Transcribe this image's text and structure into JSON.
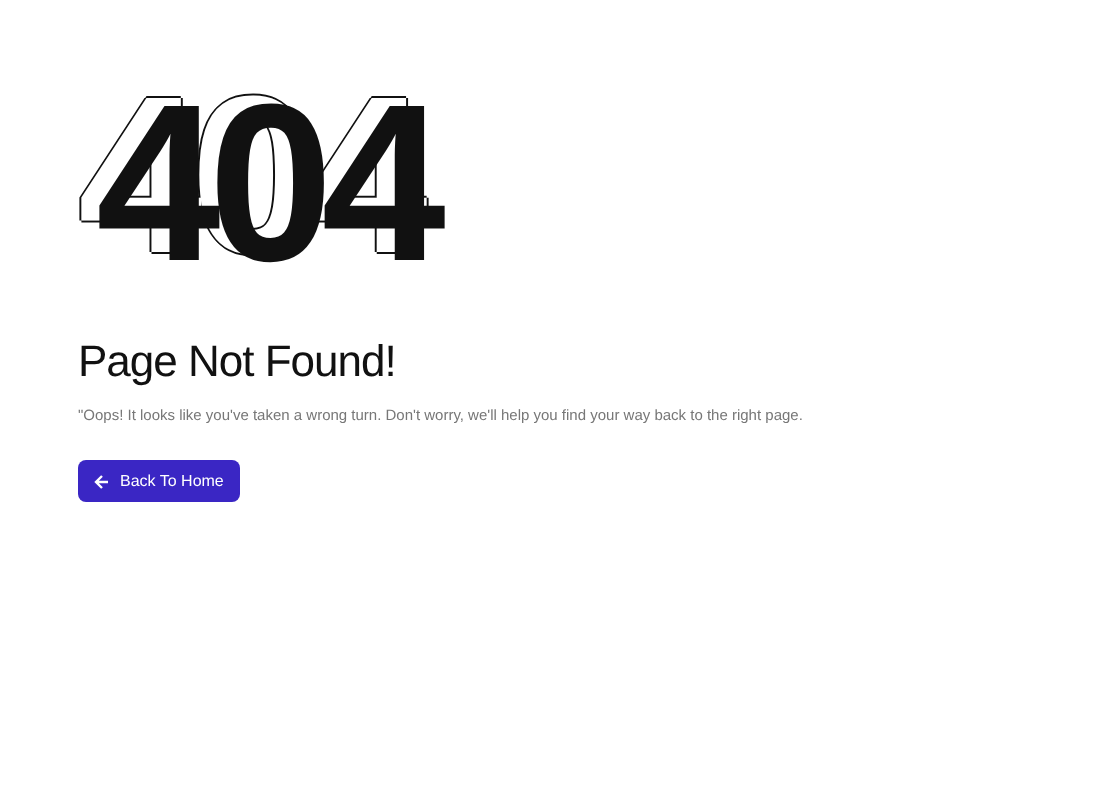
{
  "code": "404",
  "heading": "Page Not Found!",
  "message": "\"Oops! It looks like you've taken a wrong turn. Don't worry, we'll help you find your way back to the right page.",
  "button": {
    "label": "Back To Home"
  }
}
